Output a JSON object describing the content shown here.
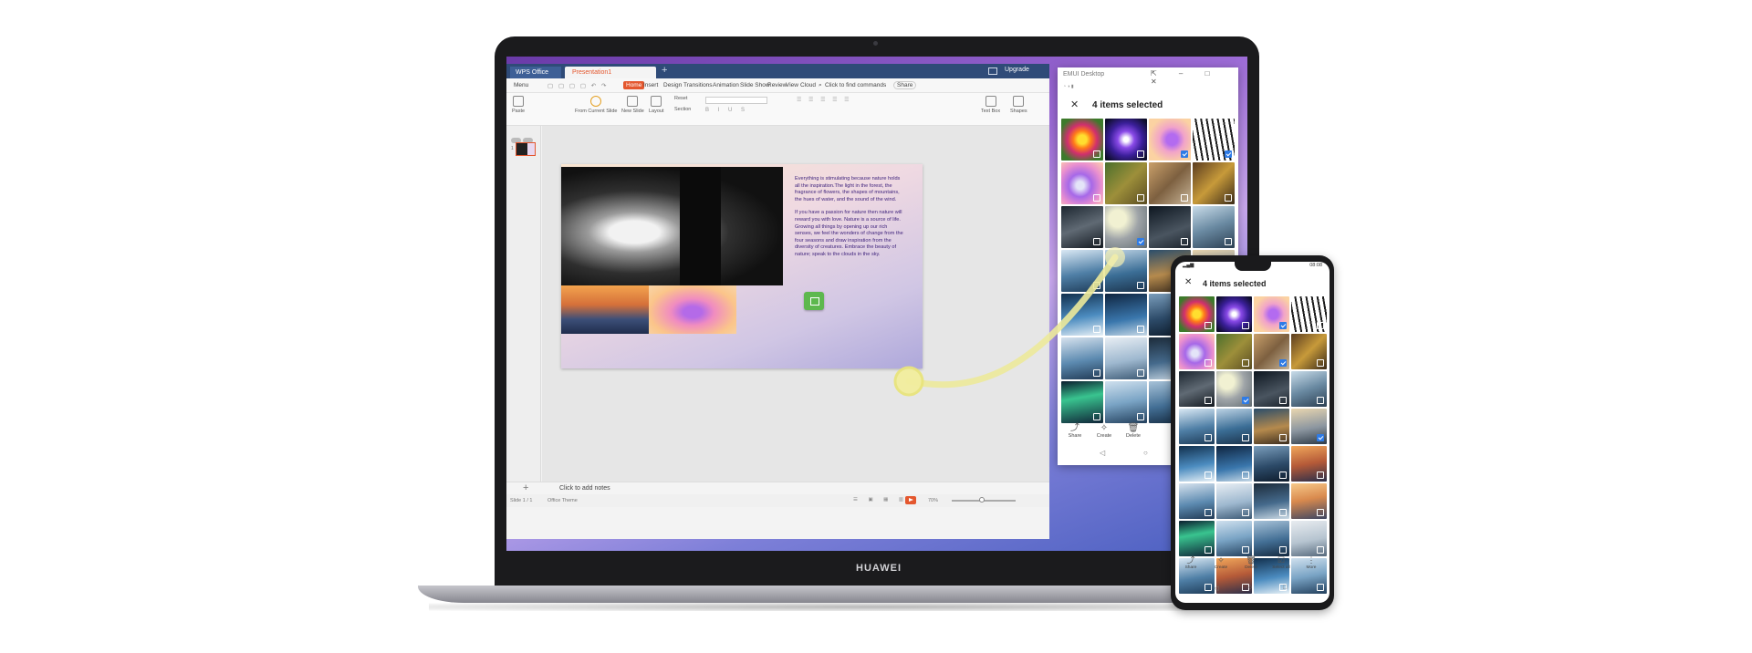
{
  "laptop": {
    "brand": "HUAWEI",
    "wps": {
      "app_tab": "WPS Office",
      "doc_tab": "Presentation1",
      "upgrade": "Upgrade",
      "menu": "Menu",
      "menu_tabs": [
        "Home",
        "Insert",
        "Design",
        "Transitions",
        "Animation",
        "Slide Show",
        "Review",
        "View",
        "Cloud"
      ],
      "search": "Click to find commands",
      "share": "Share",
      "ribbon": {
        "paste": "Paste",
        "from_current_slide": "From Current Slide",
        "new_slide": "New Slide",
        "layout": "Layout",
        "reset": "Reset",
        "section": "Section",
        "text_box": "Text Box",
        "shapes": "Shapes"
      },
      "thumb_number": "1",
      "slide": {
        "paragraph1": "Everything is stimulating because nature holds all the inspiration.The light in the forest, the fragrance of flowers, the shapes of mountains, the hues of water, and the sound of the wind.",
        "paragraph2": "If you have a passion for nature then nature will reward you with love. Nature is a source of life. Growing all things by opening up our rich senses, we feel the wonders of change from the four seasons and draw inspiration from the diversity of creatures. Embrace the beauty of nature; speak to the clouds in the sky."
      },
      "notes_placeholder": "Click to add notes",
      "status": {
        "slide": "Slide 1 / 1",
        "theme": "Office Theme",
        "zoom": "70%"
      }
    },
    "emui_window": {
      "title": "EMUI Desktop",
      "selection_text": "4 items selected",
      "actions": [
        "Share",
        "Create",
        "Delete"
      ],
      "tiles": [
        {
          "c": "t1",
          "sel": false
        },
        {
          "c": "t2",
          "sel": false
        },
        {
          "c": "t3",
          "sel": true
        },
        {
          "c": "t4",
          "sel": true
        },
        {
          "c": "t5",
          "sel": false
        },
        {
          "c": "t6",
          "sel": false
        },
        {
          "c": "t7",
          "sel": false
        },
        {
          "c": "t8",
          "sel": false
        },
        {
          "c": "t9",
          "sel": false
        },
        {
          "c": "t10",
          "sel": true
        },
        {
          "c": "t11",
          "sel": false
        },
        {
          "c": "t12",
          "sel": false
        },
        {
          "c": "t13",
          "sel": false
        },
        {
          "c": "t14",
          "sel": false
        },
        {
          "c": "t15",
          "sel": false
        },
        {
          "c": "t16",
          "sel": false
        },
        {
          "c": "t17",
          "sel": false
        },
        {
          "c": "t18",
          "sel": false
        },
        {
          "c": "t19",
          "sel": false
        },
        {
          "c": "t20",
          "sel": false
        },
        {
          "c": "t21",
          "sel": false
        },
        {
          "c": "t22",
          "sel": false
        },
        {
          "c": "t23",
          "sel": false
        },
        {
          "c": "t24",
          "sel": false
        },
        {
          "c": "t25",
          "sel": false
        },
        {
          "c": "t26",
          "sel": false
        },
        {
          "c": "t27",
          "sel": false
        },
        {
          "c": "t28",
          "sel": false
        }
      ]
    }
  },
  "phone": {
    "time": "08:08",
    "selection_text": "4 items selected",
    "actions": [
      "Share",
      "Create",
      "Delete",
      "Select all",
      "More"
    ],
    "tiles": [
      {
        "c": "t1",
        "sel": false
      },
      {
        "c": "t2",
        "sel": false
      },
      {
        "c": "t3",
        "sel": true
      },
      {
        "c": "t4",
        "sel": false
      },
      {
        "c": "t5",
        "sel": false
      },
      {
        "c": "t6",
        "sel": false
      },
      {
        "c": "t7",
        "sel": true
      },
      {
        "c": "t8",
        "sel": false
      },
      {
        "c": "t9",
        "sel": false
      },
      {
        "c": "t10",
        "sel": true
      },
      {
        "c": "t11",
        "sel": false
      },
      {
        "c": "t12",
        "sel": false
      },
      {
        "c": "t13",
        "sel": false
      },
      {
        "c": "t14",
        "sel": false
      },
      {
        "c": "t15",
        "sel": false
      },
      {
        "c": "t16",
        "sel": true
      },
      {
        "c": "t17",
        "sel": false
      },
      {
        "c": "t18",
        "sel": false
      },
      {
        "c": "t19",
        "sel": false
      },
      {
        "c": "t20",
        "sel": false
      },
      {
        "c": "t21",
        "sel": false
      },
      {
        "c": "t22",
        "sel": false
      },
      {
        "c": "t23",
        "sel": false
      },
      {
        "c": "t24",
        "sel": false
      },
      {
        "c": "t25",
        "sel": false
      },
      {
        "c": "t26",
        "sel": false
      },
      {
        "c": "t27",
        "sel": false
      },
      {
        "c": "t28",
        "sel": false
      },
      {
        "c": "t13",
        "sel": false
      },
      {
        "c": "t20",
        "sel": false
      },
      {
        "c": "t17",
        "sel": false
      },
      {
        "c": "t26",
        "sel": false
      }
    ]
  },
  "colors": {
    "wps_accent": "#e4572e",
    "titlebar": "#2f4b78",
    "selection_blue": "#2e7be6",
    "drag_path": "#ece99a",
    "drop_icon": "#5db84e"
  }
}
